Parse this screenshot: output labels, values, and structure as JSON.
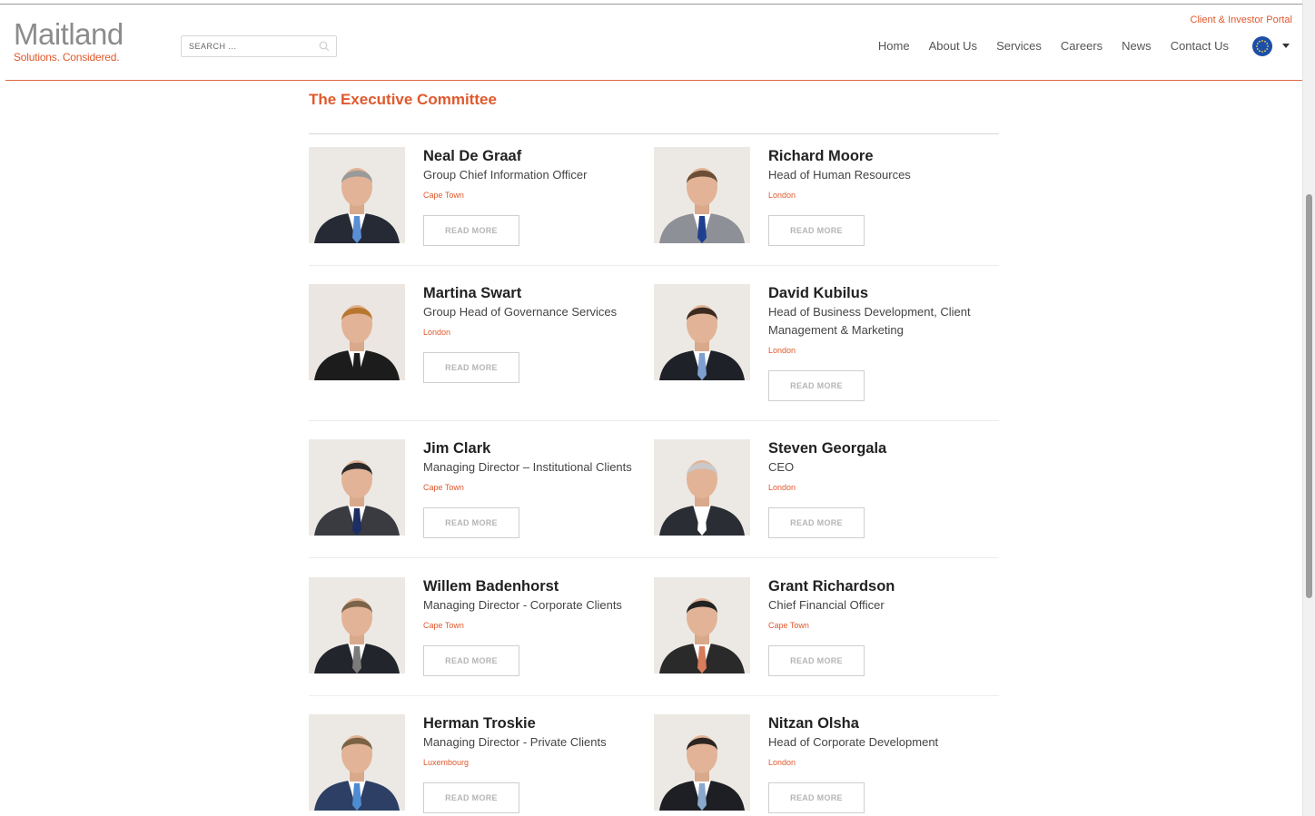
{
  "brand": {
    "logo_word": "Maitland",
    "tagline": "Solutions. Considered."
  },
  "search": {
    "placeholder": "SEARCH ..."
  },
  "portal_link": "Client & Investor Portal",
  "nav": [
    "Home",
    "About Us",
    "Services",
    "Careers",
    "News",
    "Contact Us"
  ],
  "colors": {
    "accent": "#e0592d",
    "globe": "#1d4fa8"
  },
  "section_title": "The Executive Committee",
  "read_more_label": "READ MORE",
  "people": [
    {
      "name": "Neal De Graaf",
      "role": "Group Chief Information Officer",
      "location": "Cape Town",
      "tie": "#5a8fd6",
      "suit": "#252a35",
      "hair": "#9a9a9a",
      "bg": "#ece9e4"
    },
    {
      "name": "Richard Moore",
      "role": "Head of Human Resources",
      "location": "London",
      "tie": "#1f3f8f",
      "suit": "#8d9096",
      "hair": "#6b4e36",
      "bg": "#ece9e4"
    },
    {
      "name": "Martina Swart",
      "role": "Group Head of Governance Services",
      "location": "London",
      "tie": "#1c1c1c",
      "suit": "#1c1c1c",
      "hair": "#b7772f",
      "bg": "#ebe6e1"
    },
    {
      "name": "David Kubilus",
      "role": "Head of Business Development, Client Management & Marketing",
      "location": "London",
      "tie": "#7da0d0",
      "suit": "#1f2128",
      "hair": "#3a2a20",
      "bg": "#ece9e4"
    },
    {
      "name": "Jim Clark",
      "role": "Managing Director – Institutional Clients",
      "location": "Cape Town",
      "tie": "#1c2e63",
      "suit": "#393b40",
      "hair": "#2a2a2a",
      "bg": "#ece9e4"
    },
    {
      "name": "Steven Georgala",
      "role": "CEO",
      "location": "London",
      "tie": "#ffffff",
      "suit": "#2a2d33",
      "hair": "#c9c9c9",
      "bg": "#ece9e4"
    },
    {
      "name": "Willem Badenhorst",
      "role": "Managing Director - Corporate Clients",
      "location": "Cape Town",
      "tie": "#7b7b7b",
      "suit": "#22252c",
      "hair": "#7b6349",
      "bg": "#ece9e4"
    },
    {
      "name": "Grant Richardson",
      "role": "Chief Financial Officer",
      "location": "Cape Town",
      "tie": "#d97c5c",
      "suit": "#2a2a2a",
      "hair": "#222222",
      "bg": "#ece9e4"
    },
    {
      "name": "Herman Troskie",
      "role": "Managing Director - Private Clients",
      "location": "Luxembourg",
      "tie": "#4e8bd1",
      "suit": "#2d3f64",
      "hair": "#7a6244",
      "bg": "#ece9e4"
    },
    {
      "name": "Nitzan Olsha",
      "role": "Head of Corporate Development",
      "location": "London",
      "tie": "#8aa7cc",
      "suit": "#1d1f24",
      "hair": "#2b2420",
      "bg": "#ece9e4"
    }
  ]
}
